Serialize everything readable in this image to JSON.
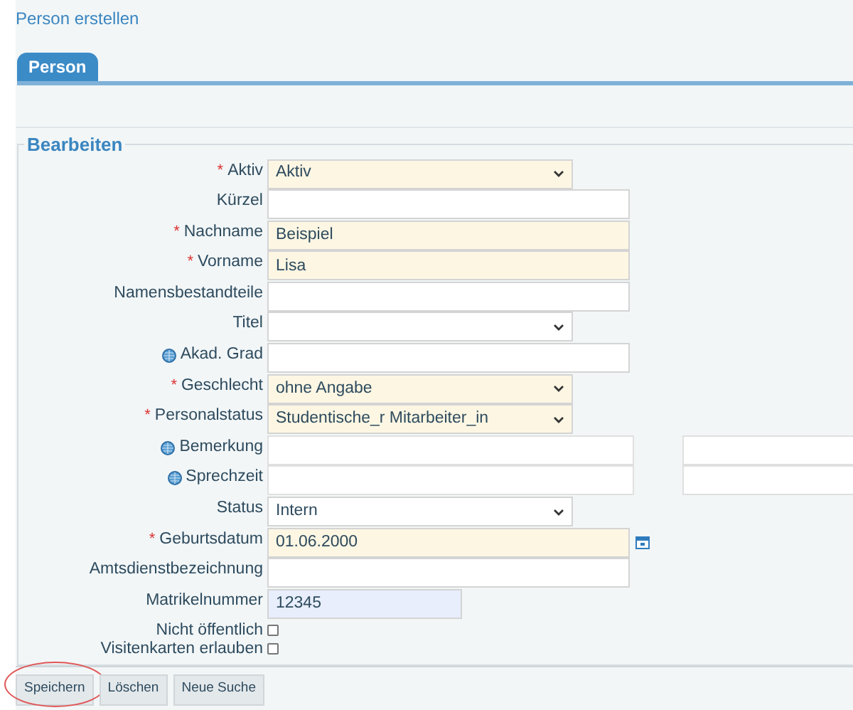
{
  "page_title": "Person erstellen",
  "tabs": [
    {
      "label": "Person",
      "selected": true
    }
  ],
  "section": {
    "legend": "Bearbeiten"
  },
  "fields": [
    {
      "label": "Aktiv",
      "kind": "select",
      "required_mark": "*",
      "translatable": false,
      "value": "Aktiv"
    },
    {
      "label": "Kürzel",
      "kind": "text",
      "translatable": false
    },
    {
      "label": "Nachname",
      "kind": "text",
      "required_mark": "*",
      "translatable": false,
      "value": "Beispiel"
    },
    {
      "label": "Vorname",
      "kind": "text",
      "required_mark": "*",
      "translatable": false,
      "value": "Lisa"
    },
    {
      "label": "Namensbestandteile",
      "kind": "text",
      "translatable": false
    },
    {
      "label": "Titel",
      "kind": "select",
      "translatable": false
    },
    {
      "label": "Akad. Grad",
      "kind": "text",
      "translatable": true
    },
    {
      "label": "Geschlecht",
      "kind": "select",
      "required_mark": "*",
      "translatable": false,
      "value": "ohne Angabe"
    },
    {
      "label": "Personalstatus",
      "kind": "select",
      "required_mark": "*",
      "translatable": false,
      "value": "Studentische_r Mitarbeiter_in"
    },
    {
      "label": "Bemerkung",
      "kind": "dual",
      "translatable": true
    },
    {
      "label": "Sprechzeit",
      "kind": "dual",
      "translatable": true
    },
    {
      "label": "Status",
      "kind": "select",
      "translatable": false,
      "value": "Intern"
    },
    {
      "label": "Geburtsdatum",
      "kind": "date",
      "required_mark": "*",
      "translatable": false,
      "value": "01.06.2000"
    },
    {
      "label": "Amtsdienstbezeichnung",
      "kind": "text",
      "translatable": false
    },
    {
      "label": "Matrikelnummer",
      "kind": "text",
      "translatable": false,
      "readonly": true,
      "value": "12345"
    },
    {
      "label": "Nicht öffentlich",
      "kind": "checkbox",
      "checked": false
    },
    {
      "label": "Visitenkarten erlauben",
      "kind": "checkbox",
      "checked": false
    }
  ],
  "buttons": [
    {
      "label": "Speichern",
      "circled": true
    },
    {
      "label": "Löschen",
      "circled": false
    },
    {
      "label": "Neue Suche",
      "circled": false
    }
  ]
}
